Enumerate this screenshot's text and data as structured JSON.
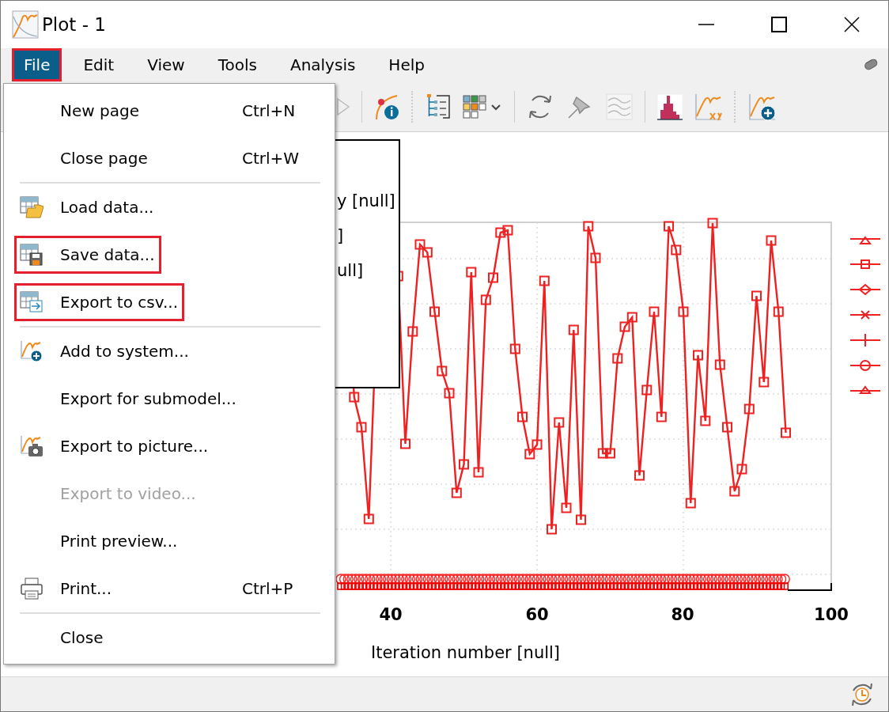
{
  "window": {
    "title": "Plot - 1"
  },
  "menu_bar": [
    {
      "label": "File",
      "selected": true,
      "highlighted": true
    },
    {
      "label": "Edit",
      "selected": false,
      "highlighted": false
    },
    {
      "label": "View",
      "selected": false,
      "highlighted": false
    },
    {
      "label": "Tools",
      "selected": false,
      "highlighted": false
    },
    {
      "label": "Analysis",
      "selected": false,
      "highlighted": false
    },
    {
      "label": "Help",
      "selected": false,
      "highlighted": false
    }
  ],
  "file_menu": [
    {
      "kind": "item",
      "label": "New page",
      "shortcut": "Ctrl+N",
      "disabled": false,
      "highlighted": false
    },
    {
      "kind": "item",
      "label": "Close page",
      "shortcut": "Ctrl+W",
      "disabled": false,
      "highlighted": false
    },
    {
      "kind": "separator"
    },
    {
      "kind": "item",
      "label": "Load data...",
      "disabled": false,
      "highlighted": false
    },
    {
      "kind": "item",
      "label": "Save data...",
      "disabled": false,
      "highlighted": true
    },
    {
      "kind": "item",
      "label": "Export to csv...",
      "disabled": false,
      "highlighted": true
    },
    {
      "kind": "separator"
    },
    {
      "kind": "item",
      "label": "Add to system...",
      "disabled": false,
      "highlighted": false
    },
    {
      "kind": "item",
      "label": "Export for submodel...",
      "disabled": false,
      "highlighted": false
    },
    {
      "kind": "item",
      "label": "Export to picture...",
      "disabled": false,
      "highlighted": false
    },
    {
      "kind": "item",
      "label": "Export to video...",
      "disabled": true,
      "highlighted": false
    },
    {
      "kind": "item",
      "label": "Print preview...",
      "disabled": false,
      "highlighted": false
    },
    {
      "kind": "item",
      "label": "Print...",
      "shortcut": "Ctrl+P",
      "disabled": false,
      "highlighted": false
    },
    {
      "kind": "separator"
    },
    {
      "kind": "item",
      "label": "Close",
      "disabled": false,
      "highlighted": false
    }
  ],
  "plot": {
    "legend_texts": [
      "y [null]",
      "]",
      "ull]"
    ],
    "x_ticks": [
      "40",
      "60",
      "80",
      "100"
    ],
    "x_label": "Iteration number [null]"
  }
}
